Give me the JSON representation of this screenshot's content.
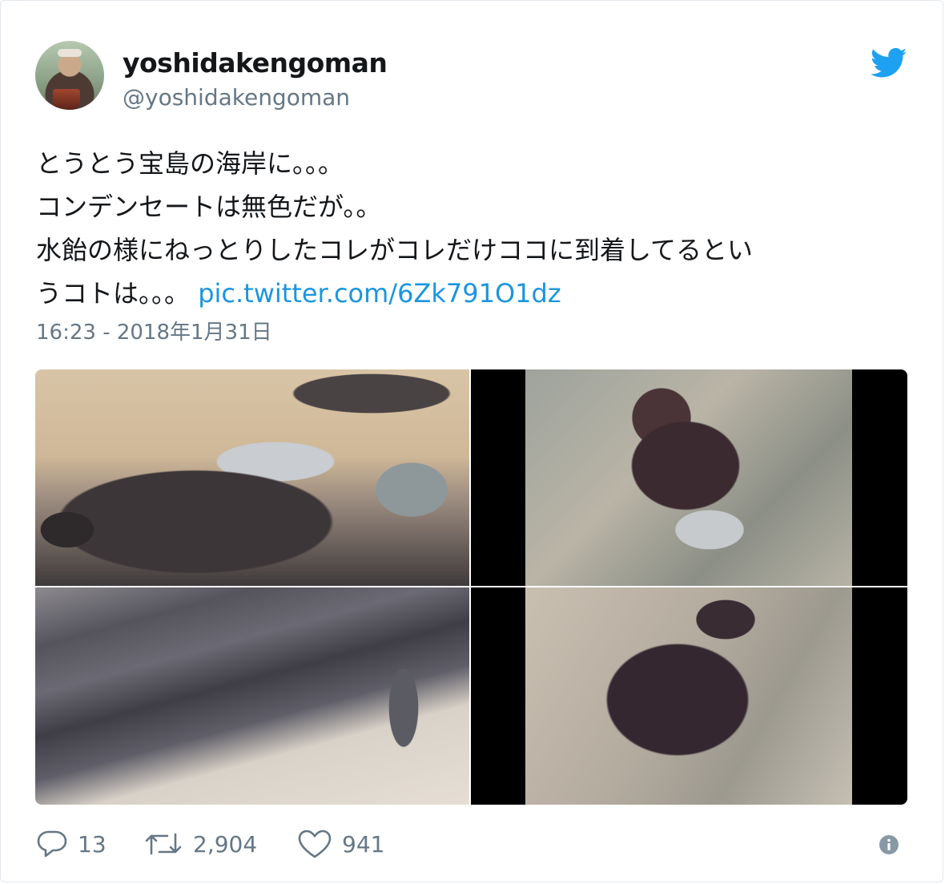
{
  "user": {
    "display_name": "yoshidakengoman",
    "handle": "@yoshidakengoman"
  },
  "tweet": {
    "text": "とうとう宝島の海岸に。。。\nコンデンセートは無色だが。。\n水飴の様にねっとりしたコレがコレだけココに到着してるとい\nうコトは。。。 ",
    "link": "pic.twitter.com/6Zk791O1dz",
    "timestamp": "16:23 - 2018年1月31日"
  },
  "media": {
    "photos": [
      "oil-on-beach-rocks",
      "oil-on-coral-rock-1",
      "oil-on-concrete-steps",
      "oil-on-coral-rock-2"
    ]
  },
  "actions": {
    "reply_count": "13",
    "retweet_count": "2,904",
    "like_count": "941"
  },
  "icons": {
    "brand": "twitter-bird-icon",
    "reply": "reply-icon",
    "retweet": "retweet-icon",
    "like": "heart-icon",
    "info": "info-icon"
  },
  "colors": {
    "brand_blue": "#1da1f2",
    "link": "#1b95e0",
    "secondary_text": "#657786"
  }
}
